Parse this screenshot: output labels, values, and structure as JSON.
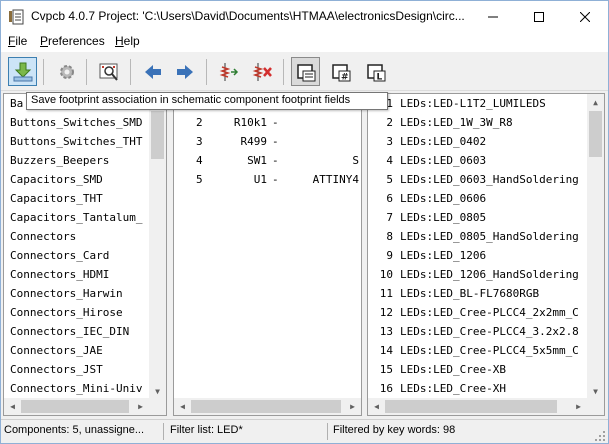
{
  "window": {
    "title": "Cvpcb 4.0.7  Project: 'C:\\Users\\David\\Documents\\HTMAA\\electronicsDesign\\circ..."
  },
  "menu": {
    "file_key": "F",
    "file_rest": "ile",
    "prefs_key": "P",
    "prefs_rest": "references",
    "help_key": "H",
    "help_rest": "elp"
  },
  "toolbar": {
    "tooltip": "Save footprint association in schematic component footprint fields",
    "icons": [
      "save-icon",
      "gear-icon",
      "footprint-viewer-icon",
      "arrow-left-icon",
      "arrow-right-icon",
      "auto-associate-icon",
      "delete-associations-icon",
      "filter-keywords-icon",
      "filter-pincount-icon",
      "filter-library-icon"
    ]
  },
  "libraries": [
    "Ba",
    "Buttons_Switches_SMD",
    "Buttons_Switches_THT",
    "Buzzers_Beepers",
    "Capacitors_SMD",
    "Capacitors_THT",
    "Capacitors_Tantalum_",
    "Connectors",
    "Connectors_Card",
    "Connectors_HDMI",
    "Connectors_Harwin",
    "Connectors_Hirose",
    "Connectors_IEC_DIN",
    "Connectors_JAE",
    "Connectors_JST",
    "Connectors_Mini-Univ"
  ],
  "components": [
    {
      "num": "2",
      "ref": "R10k1",
      "dash": "-",
      "value": ""
    },
    {
      "num": "3",
      "ref": "R499",
      "dash": "-",
      "value": ""
    },
    {
      "num": "4",
      "ref": "SW1",
      "dash": "-",
      "value": "S"
    },
    {
      "num": "5",
      "ref": "U1",
      "dash": "-",
      "value": "ATTINY4"
    }
  ],
  "footprints": [
    {
      "num": "1",
      "name": "LEDs:LED-L1T2_LUMILEDS"
    },
    {
      "num": "2",
      "name": "LEDs:LED_1W_3W_R8"
    },
    {
      "num": "3",
      "name": "LEDs:LED_0402"
    },
    {
      "num": "4",
      "name": "LEDs:LED_0603"
    },
    {
      "num": "5",
      "name": "LEDs:LED_0603_HandSoldering"
    },
    {
      "num": "6",
      "name": "LEDs:LED_0606"
    },
    {
      "num": "7",
      "name": "LEDs:LED_0805"
    },
    {
      "num": "8",
      "name": "LEDs:LED_0805_HandSoldering"
    },
    {
      "num": "9",
      "name": "LEDs:LED_1206"
    },
    {
      "num": "10",
      "name": "LEDs:LED_1206_HandSoldering"
    },
    {
      "num": "11",
      "name": "LEDs:LED_BL-FL7680RGB"
    },
    {
      "num": "12",
      "name": "LEDs:LED_Cree-PLCC4_2x2mm_C"
    },
    {
      "num": "13",
      "name": "LEDs:LED_Cree-PLCC4_3.2x2.8"
    },
    {
      "num": "14",
      "name": "LEDs:LED_Cree-PLCC4_5x5mm_C"
    },
    {
      "num": "15",
      "name": "LEDs:LED_Cree-XB"
    },
    {
      "num": "16",
      "name": "LEDs:LED_Cree-XH"
    }
  ],
  "status": {
    "components": "Components: 5, unassigne...",
    "filter": "Filter list: LED*",
    "filtered": "Filtered by key words: 98"
  },
  "colors": {
    "accent_blue": "#3c7fb1",
    "toolbar_active_bg": "#cce4f7"
  }
}
